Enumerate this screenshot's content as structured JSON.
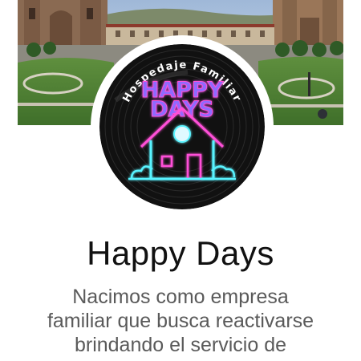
{
  "profile": {
    "name": "Happy Days",
    "bio_lines": [
      "Nacimos como empresa",
      "familiar que busca reactivarse",
      "brindando el servicio de"
    ]
  },
  "logo": {
    "arc_text": "Hospedaje Familiar",
    "title_line1": "HAPPY",
    "title_line2": "DAYS"
  },
  "colors": {
    "page_background": "#ffffff",
    "name_text": "#111111",
    "bio_text": "#5a5a5a",
    "logo_record": "#111111",
    "neon_pink": "#ff4fd8",
    "neon_cyan": "#59f3ff",
    "neon_purple": "#8f6bff"
  }
}
